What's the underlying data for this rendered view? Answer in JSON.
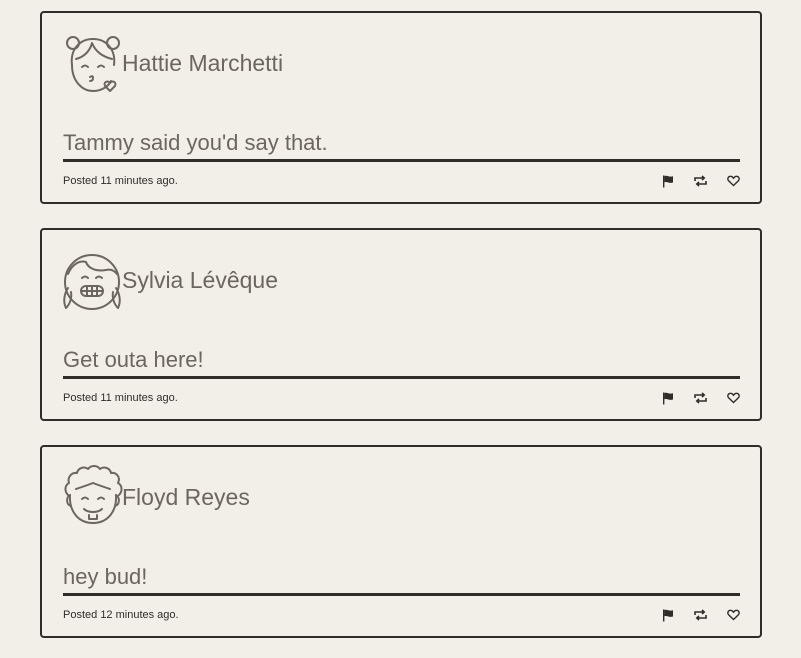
{
  "posts": [
    {
      "author": "Hattie Marchetti",
      "avatar_icon": "girl-buns-kiss-avatar-icon",
      "message": "Tammy said you'd say that.",
      "posted_prefix": "Posted",
      "posted_time": "11 minutes ago."
    },
    {
      "author": "Sylvia Lévêque",
      "avatar_icon": "girl-pigtails-grin-avatar-icon",
      "message": "Get outa here!",
      "posted_prefix": "Posted",
      "posted_time": "11 minutes ago."
    },
    {
      "author": "Floyd Reyes",
      "avatar_icon": "curly-hair-man-avatar-icon",
      "message": "hey bud!",
      "posted_prefix": "Posted",
      "posted_time": "12 minutes ago."
    }
  ],
  "actions": {
    "flag_icon": "flag-icon",
    "repost_icon": "repost-icon",
    "like_icon": "heart-icon"
  },
  "colors": {
    "background": "#f1efe8",
    "border": "#2f2d28",
    "text": "#6b675e"
  }
}
